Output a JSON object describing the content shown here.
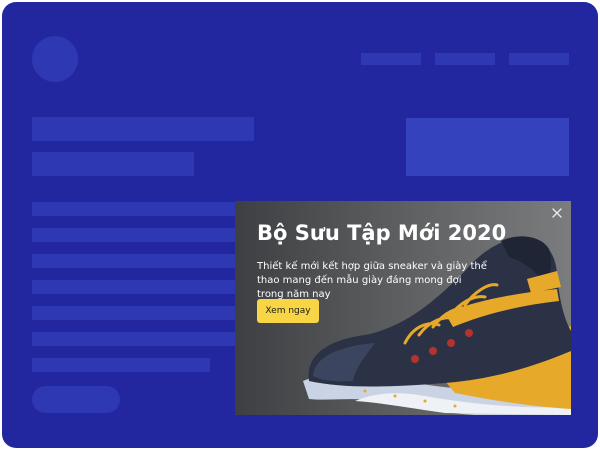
{
  "colors": {
    "page_bg": "#2227a0",
    "skeleton_block": "#2e38b2",
    "skeleton_block_light": "#3442bd",
    "popup_button": "#f7d545",
    "shoe_navy": "#2b3246",
    "shoe_gold": "#e7a92a",
    "shoe_sole": "#c9d3e3"
  },
  "popup": {
    "title": "Bộ Sưu Tập Mới 2020",
    "description": "Thiết kế mới kết hợp giữa sneaker và giày thể thao mang đến mẫu giày đáng mong đợi trong năm nay",
    "cta_label": "Xem ngay",
    "close_icon": "close-icon",
    "image": "sneaker-image"
  }
}
